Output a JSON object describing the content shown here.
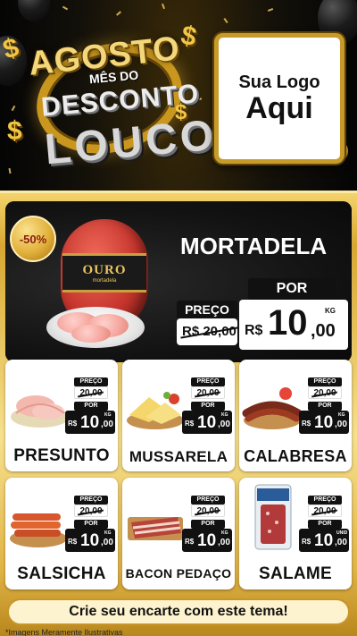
{
  "header": {
    "title_line1": "AGOSTO",
    "title_line2": "MÊS DO",
    "title_line3": "DESCONTO",
    "title_line4": "LOUCO",
    "dollar_sign": "$",
    "logo_line1": "Sua Logo",
    "logo_line2": "Aqui"
  },
  "featured": {
    "discount": "-50%",
    "name": "MORTADELA",
    "brand_label": "OURO",
    "brand_sub": "mortadela",
    "old_label": "PREÇO",
    "old_price": "R$ 20,00",
    "new_label": "POR",
    "currency": "R$",
    "new_price_int": "10",
    "new_price_dec": ",00",
    "unit": "KG"
  },
  "products": [
    {
      "name": "PRESUNTO",
      "old_label": "PREÇO",
      "old_price": "20,00",
      "new_label": "POR",
      "currency": "R$",
      "int": "10",
      "dec": ",00",
      "unit": "KG"
    },
    {
      "name": "MUSSARELA",
      "old_label": "PREÇO",
      "old_price": "20,00",
      "new_label": "POR",
      "currency": "R$",
      "int": "10",
      "dec": ",00",
      "unit": "KG"
    },
    {
      "name": "CALABRESA",
      "old_label": "PREÇO",
      "old_price": "20,00",
      "new_label": "POR",
      "currency": "R$",
      "int": "10",
      "dec": ",00",
      "unit": "KG"
    },
    {
      "name": "SALSICHA",
      "old_label": "PREÇO",
      "old_price": "20,00",
      "new_label": "POR",
      "currency": "R$",
      "int": "10",
      "dec": ",00",
      "unit": "KG"
    },
    {
      "name": "BACON PEDAÇO",
      "old_label": "PREÇO",
      "old_price": "20,00",
      "new_label": "POR",
      "currency": "R$",
      "int": "10",
      "dec": ",00",
      "unit": "KG"
    },
    {
      "name": "SALAME",
      "old_label": "PREÇO",
      "old_price": "20,00",
      "new_label": "POR",
      "currency": "R$",
      "int": "10",
      "dec": ",00",
      "unit": "UNID"
    }
  ],
  "footer": {
    "cta": "Crie seu encarte com este tema!",
    "note": "*Imagens Meramente Ilustrativas"
  },
  "colors": {
    "gold": "#d7a733",
    "black": "#111111",
    "discount_text": "#8a1d12"
  }
}
